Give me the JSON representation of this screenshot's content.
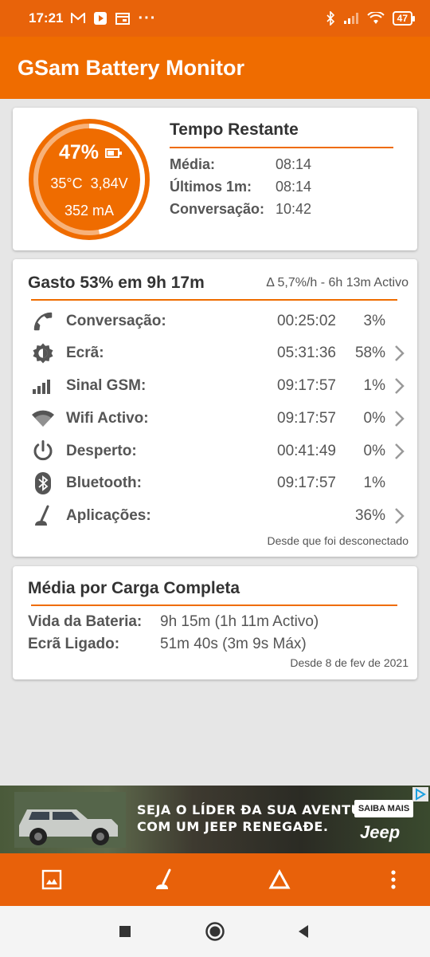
{
  "status_bar": {
    "time": "17:21",
    "battery": "47",
    "more": "···"
  },
  "app": {
    "title": "GSam Battery Monitor"
  },
  "gauge": {
    "percent": "47%",
    "level": 0.47,
    "temp": "35°C",
    "voltage": "3,84V",
    "current": "352 mA"
  },
  "tempo_restante": {
    "title": "Tempo Restante",
    "rows": [
      {
        "label": "Média:",
        "value": "08:14"
      },
      {
        "label": "Últimos 1m:",
        "value": "08:14"
      },
      {
        "label": "Conversação:",
        "value": "10:42"
      }
    ]
  },
  "gasto": {
    "title": "Gasto 53% em 9h 17m",
    "rate": "Δ 5,7%/h - 6h 13m Activo",
    "rows": [
      {
        "icon": "phone-icon",
        "label": "Conversação:",
        "time": "00:25:02",
        "pct": "3%",
        "chevron": false
      },
      {
        "icon": "screen-brightness-icon",
        "label": "Ecrã:",
        "time": "05:31:36",
        "pct": "58%",
        "chevron": true
      },
      {
        "icon": "signal-bars-icon",
        "label": "Sinal GSM:",
        "time": "09:17:57",
        "pct": "1%",
        "chevron": true
      },
      {
        "icon": "wifi-icon",
        "label": "Wifi Activo:",
        "time": "09:17:57",
        "pct": "0%",
        "chevron": true
      },
      {
        "icon": "power-icon",
        "label": "Desperto:",
        "time": "00:41:49",
        "pct": "0%",
        "chevron": true
      },
      {
        "icon": "bluetooth-icon",
        "label": "Bluetooth:",
        "time": "09:17:57",
        "pct": "1%",
        "chevron": false
      },
      {
        "icon": "apps-icon",
        "label": "Aplicações:",
        "time": "",
        "pct": "36%",
        "chevron": true
      }
    ],
    "footer": "Desde que foi desconectado"
  },
  "media_carga": {
    "title": "Média por Carga Completa",
    "rows": [
      {
        "label": "Vida da Bateria:",
        "value": "9h 15m (1h 11m Activo)"
      },
      {
        "label": "Ecrã Ligado:",
        "value": "51m 40s (3m 9s Máx)"
      }
    ],
    "footer": "Desde 8 de fev de 2021"
  },
  "ad": {
    "headline_line1": "SEJA O LÍDER ĐA SUA AVENTURA",
    "headline_line2": "COM UM JEEP RENEGAĐE.",
    "cta": "SAIBA MAIS",
    "brand": "Jeep"
  },
  "toolbar": {
    "icons": [
      "image-icon",
      "apps-icon",
      "delta-icon",
      "more-vert-icon"
    ]
  },
  "colors": {
    "primary": "#ef6c00",
    "status": "#e8630a",
    "text": "#555555"
  }
}
